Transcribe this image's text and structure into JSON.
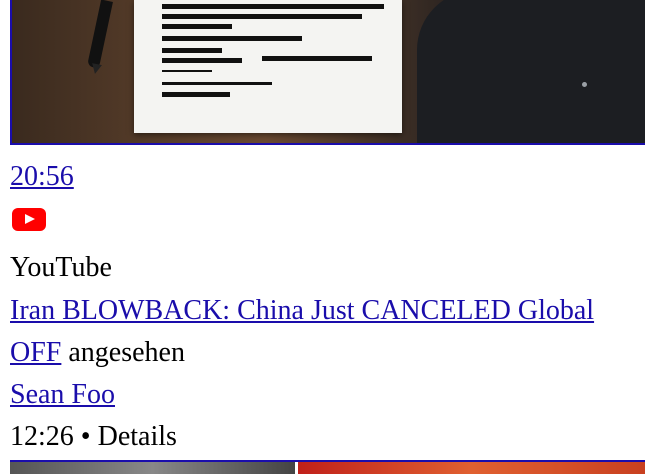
{
  "card1": {
    "duration": "20:56"
  },
  "card2": {
    "source": "YouTube",
    "title": "Iran BLOWBACK: China Just CANCELED Global",
    "title_tail": "OFF",
    "watched_suffix": " angesehen",
    "channel": "Sean Foo",
    "duration": "12:26",
    "separator": " • ",
    "details": "Details"
  },
  "icons": {
    "youtube": "youtube-icon"
  },
  "colors": {
    "link": "#1a0dab",
    "youtube_red": "#ff0000"
  }
}
